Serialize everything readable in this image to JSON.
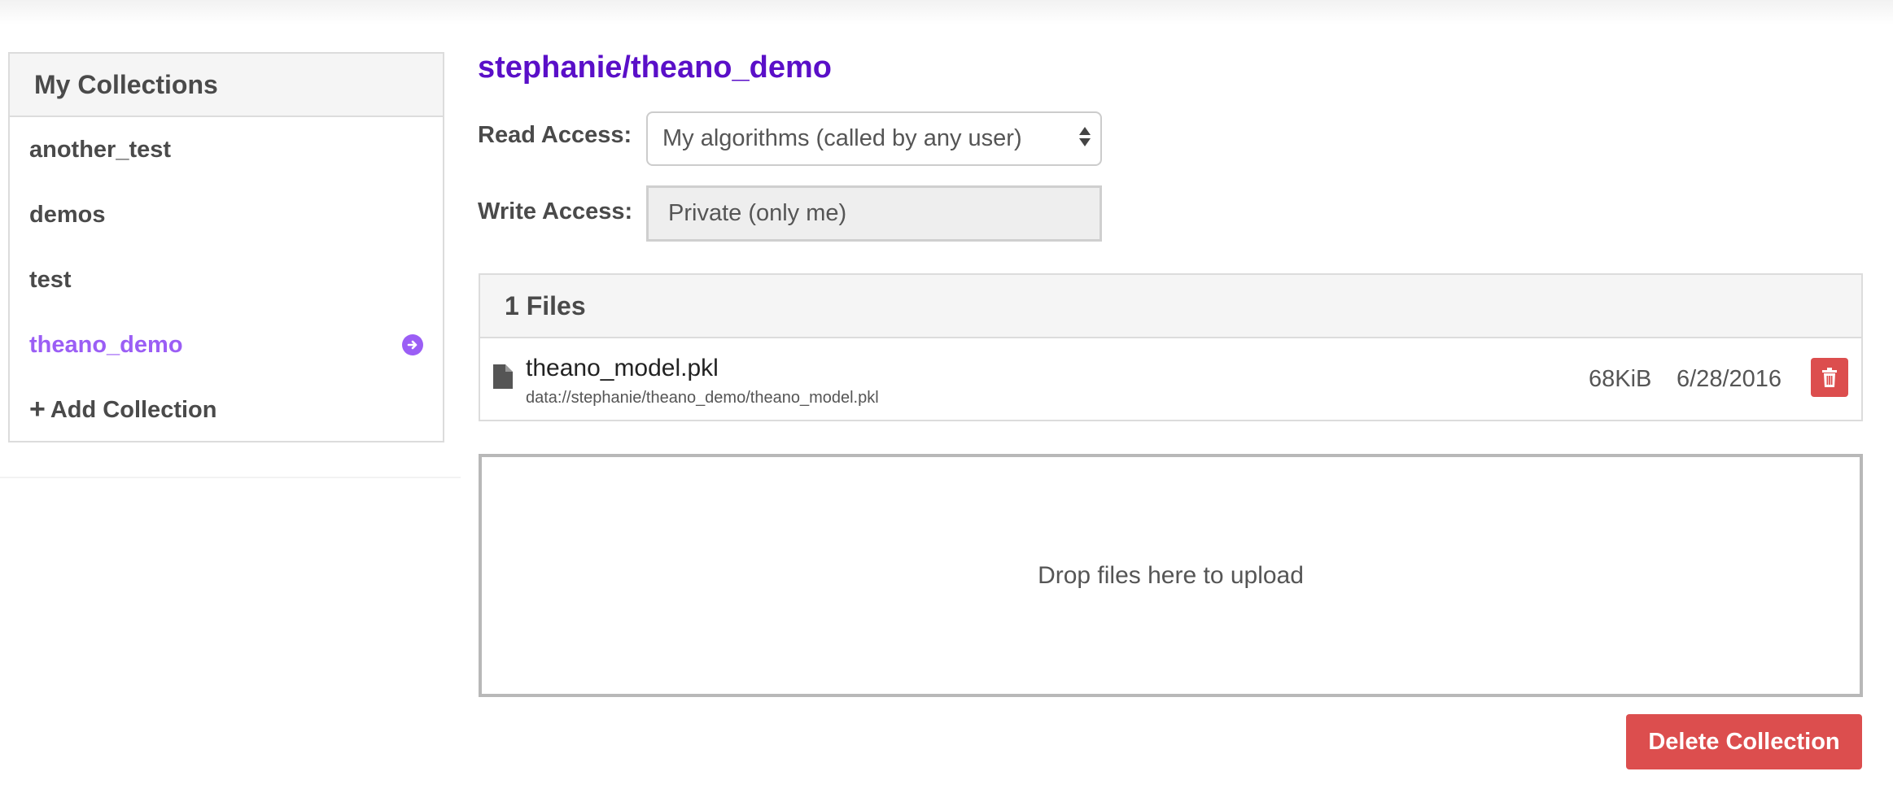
{
  "sidebar": {
    "title": "My Collections",
    "items": [
      {
        "label": "another_test"
      },
      {
        "label": "demos"
      },
      {
        "label": "test"
      },
      {
        "label": "theano_demo",
        "active": true
      }
    ],
    "add_label": "Add Collection",
    "add_icon": "plus-icon",
    "active_icon": "arrow-circle-right-icon"
  },
  "collection": {
    "title": "stephanie/theano_demo",
    "read_access_label": "Read Access:",
    "read_access_value": "My algorithms (called by any user)",
    "write_access_label": "Write Access:",
    "write_access_value": "Private (only me)"
  },
  "files": {
    "header": "1 Files",
    "rows": [
      {
        "name": "theano_model.pkl",
        "path": "data://stephanie/theano_demo/theano_model.pkl",
        "size": "68KiB",
        "date": "6/28/2016"
      }
    ]
  },
  "dropzone": {
    "text": "Drop files here to upload"
  },
  "actions": {
    "delete_label": "Delete Collection"
  },
  "colors": {
    "accent": "#9b5ef5",
    "title": "#5a0fc8",
    "danger": "#dc4e4e"
  }
}
